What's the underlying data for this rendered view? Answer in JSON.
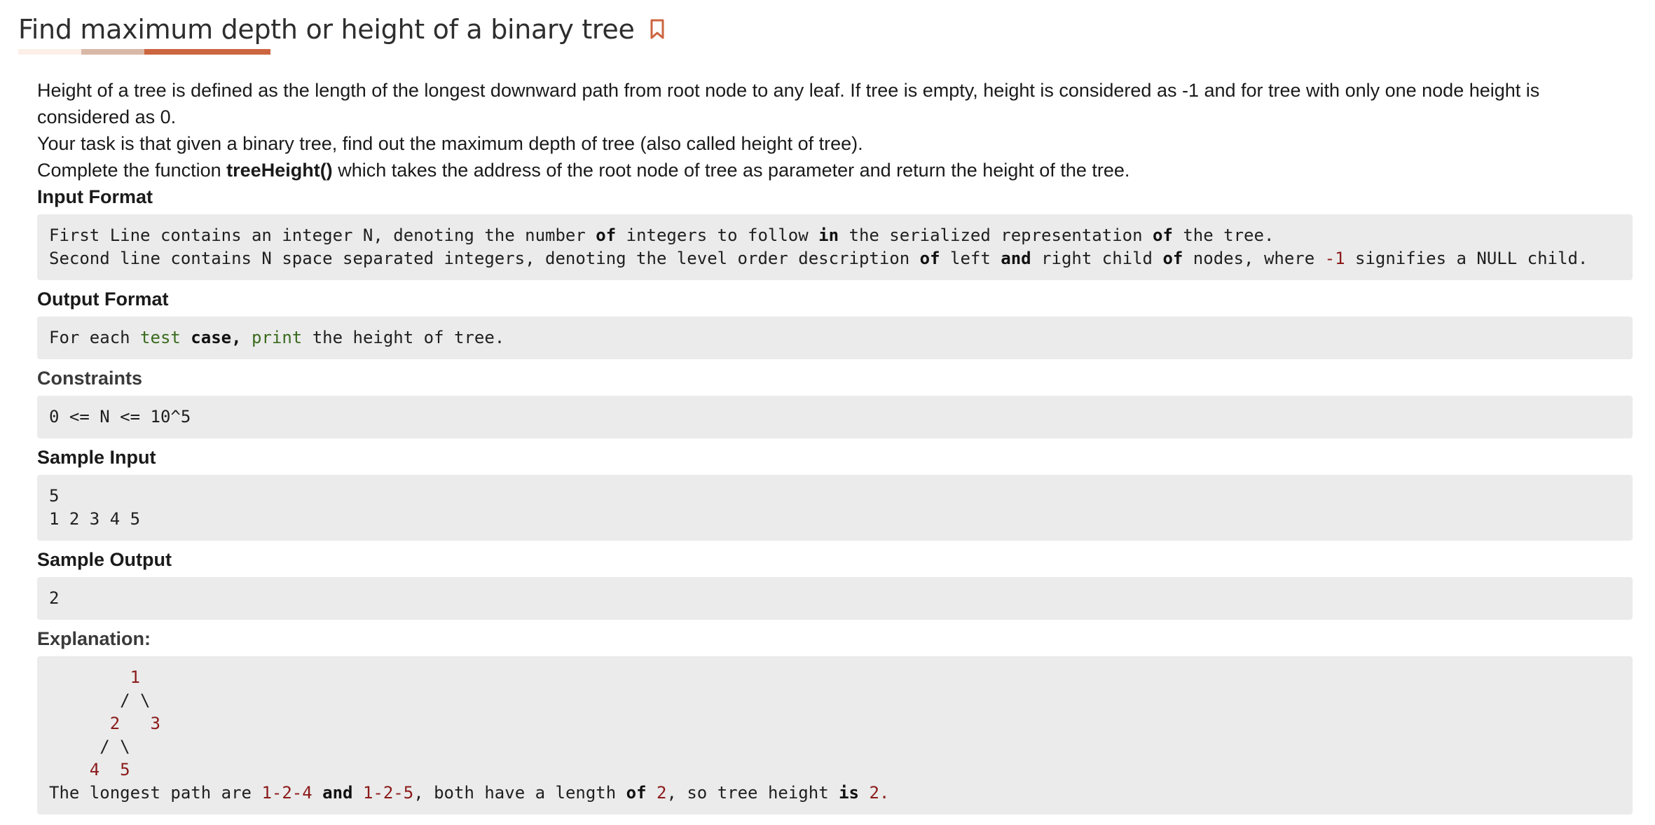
{
  "page": {
    "title": "Find maximum depth or height of a binary tree",
    "bookmark_icon": "bookmark-icon",
    "accent_color": "#cc6640"
  },
  "description": {
    "line1": "Height of a tree is defined as the length of the longest downward path from root node to any leaf. If tree is empty, height is considered as -1 and for tree with only one node height is considered as 0.",
    "line2": "Your task is that given a binary tree, find out the maximum depth of tree (also called height of tree).",
    "line3_prefix": "Complete the function ",
    "line3_function": "treeHeight()",
    "line3_suffix": " which takes the address of the root node of tree as parameter and return the height of the tree."
  },
  "sections": {
    "input_format": {
      "heading": "Input Format",
      "line1": {
        "a": "First Line contains an integer N, denoting the number ",
        "b": "of",
        "c": " integers to follow ",
        "d": "in",
        "e": " the serialized representation ",
        "f": "of",
        "g": " the tree."
      },
      "line2": {
        "a": "Second line contains N space separated integers, denoting the level order description ",
        "b": "of",
        "c": " left ",
        "d": "and",
        "e": " right child ",
        "f": "of",
        "g": " nodes, where ",
        "h": "-1",
        "i": " signifies a NULL child."
      }
    },
    "output_format": {
      "heading": "Output Format",
      "a": "For each ",
      "b": "test",
      "c": " ",
      "d": "case,",
      "e": " ",
      "f": "print",
      "g": " the height of tree."
    },
    "constraints": {
      "heading": "Constraints",
      "text": "0 <= N <= 10^5"
    },
    "sample_input": {
      "heading": "Sample Input",
      "line1": "5",
      "line2": "1 2 3 4 5"
    },
    "sample_output": {
      "heading": "Sample Output",
      "text": "2"
    },
    "explanation": {
      "heading": "Explanation:",
      "tree": {
        "r1_pad": "        ",
        "r1_n": "1",
        "r2": "       / \\",
        "r3_pad": "      ",
        "r3_a": "2",
        "r3_gap": "   ",
        "r3_b": "3",
        "r4": "     / \\",
        "r5_pad": "    ",
        "r5_a": "4",
        "r5_gap": "  ",
        "r5_b": "5"
      },
      "summary": {
        "a": "The longest path are ",
        "b": "1-2-4",
        "c": " ",
        "d": "and",
        "e": " ",
        "f": "1-2-5",
        "g": ", both have a length ",
        "h": "of",
        "i": " ",
        "j": "2",
        "k": ", so tree height ",
        "l": "is",
        "m": " ",
        "n": "2."
      }
    }
  }
}
